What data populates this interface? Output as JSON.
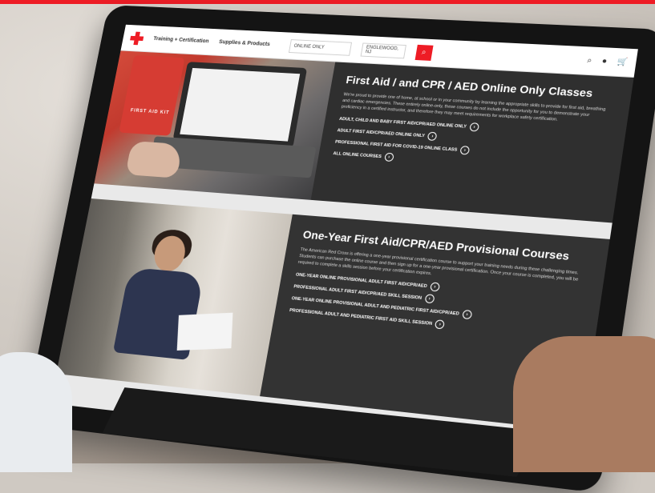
{
  "header": {
    "nav": [
      "Training + Certification",
      "Supplies & Products"
    ],
    "select_value": "ONLINE ONLY",
    "zip_value": "ENGLEWOOD, NJ"
  },
  "panel1": {
    "title": "First Aid / and CPR / AED Online Only Classes",
    "body": "We're proud to provide one of home, at school or in your community by learning the appropriate skills to provide for first aid, breathing and cardiac emergencies. These entirely online-only, these courses do not include the opportunity for you to demonstrate your proficiency in a certified instructor, and therefore they may meet requirements for workplace safety certification.",
    "links": [
      "ADULT, CHILD AND BABY FIRST AID/CPR/AED ONLINE ONLY",
      "ADULT FIRST AID/CPR/AED ONLINE ONLY",
      "PROFESSIONAL FIRST AID FOR COVID-19 ONLINE CLASS",
      "ALL ONLINE COURSES"
    ],
    "image_label": "FIRST AID KIT"
  },
  "panel2": {
    "title": "One-Year First Aid/CPR/AED Provisional Courses",
    "body": "The American Red Cross is offering a one-year provisional certification course to support your training needs during these challenging times. Students can purchase the online course and then sign up for a one-year provisional certification. Once your course is completed, you will be required to complete a skills session before your certification expires.",
    "links": [
      "ONE-YEAR ONLINE PROVISIONAL ADULT FIRST AID/CPR/AED",
      "PROFESSIONAL ADULT FIRST AID/CPR/AED SKILL SESSION",
      "ONE-YEAR ONLINE PROVISIONAL ADULT AND PEDIATRIC FIRST AID/CPR/AED",
      "PROFESSIONAL ADULT AND PEDIATRIC FIRST AID SKILL SESSION"
    ]
  },
  "icons": [
    "cross-logo-icon",
    "search-icon",
    "user-icon",
    "cart-icon",
    "arrow-circle-icon"
  ],
  "colors": {
    "brand_red": "#ee1c25",
    "panel_dark": "#2f2f2f"
  }
}
